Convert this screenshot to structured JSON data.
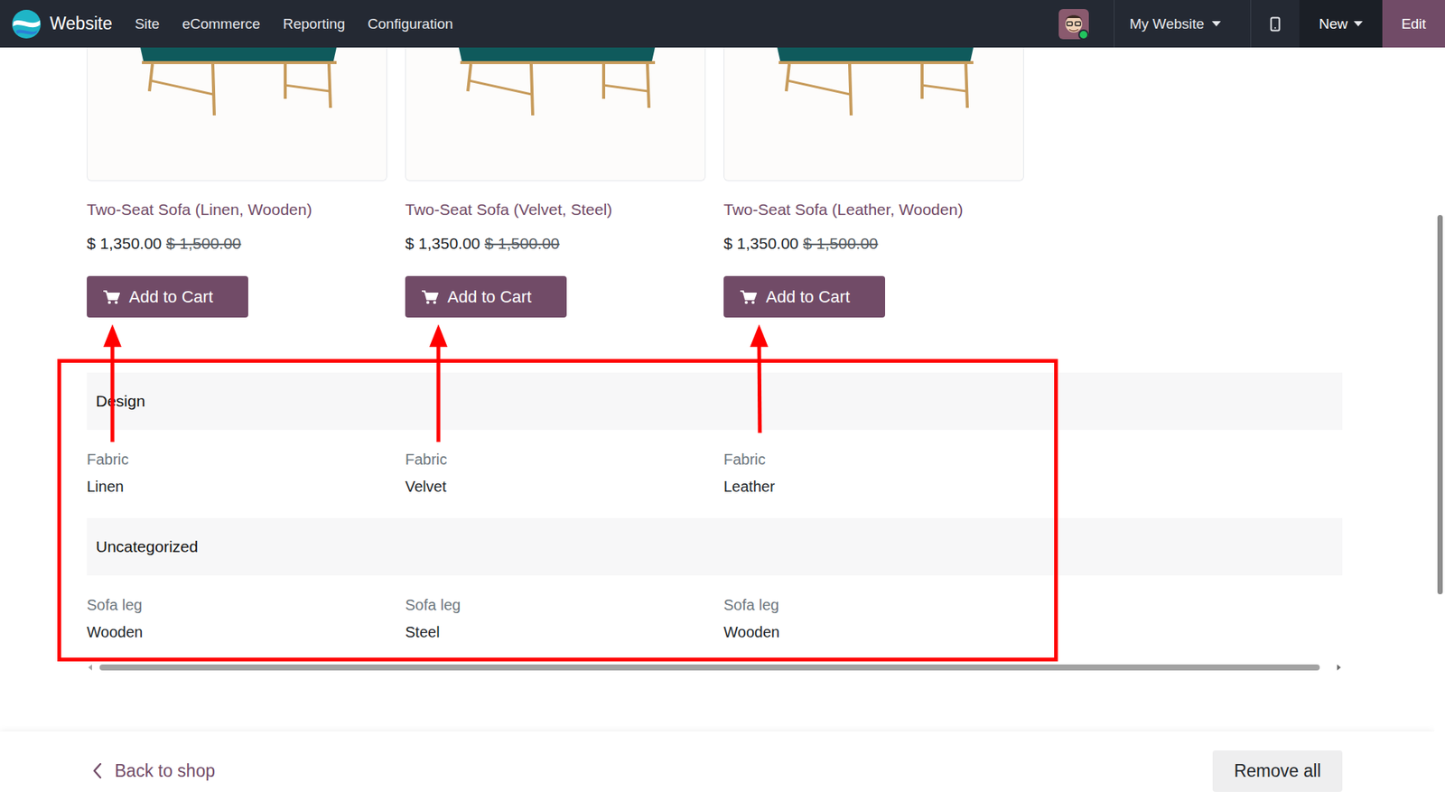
{
  "navbar": {
    "app": "Website",
    "menu": [
      "Site",
      "eCommerce",
      "Reporting",
      "Configuration"
    ],
    "website": "My Website",
    "new": "New",
    "edit": "Edit"
  },
  "products": [
    {
      "name": "Two-Seat Sofa (Linen, Wooden)",
      "price": "$ 1,350.00",
      "old_price": "$ 1,500.00",
      "button": "Add to Cart"
    },
    {
      "name": "Two-Seat Sofa (Velvet, Steel)",
      "price": "$ 1,350.00",
      "old_price": "$ 1,500.00",
      "button": "Add to Cart"
    },
    {
      "name": "Two-Seat Sofa (Leather, Wooden)",
      "price": "$ 1,350.00",
      "old_price": "$ 1,500.00",
      "button": "Add to Cart"
    }
  ],
  "sections": [
    {
      "title": "Design",
      "rows": [
        {
          "label": "Fabric",
          "values": [
            "Linen",
            "Velvet",
            "Leather"
          ]
        }
      ]
    },
    {
      "title": "Uncategorized",
      "rows": [
        {
          "label": "Sofa leg",
          "values": [
            "Wooden",
            "Steel",
            "Wooden"
          ]
        }
      ]
    }
  ],
  "footer": {
    "back": "Back to shop",
    "remove": "Remove all"
  }
}
